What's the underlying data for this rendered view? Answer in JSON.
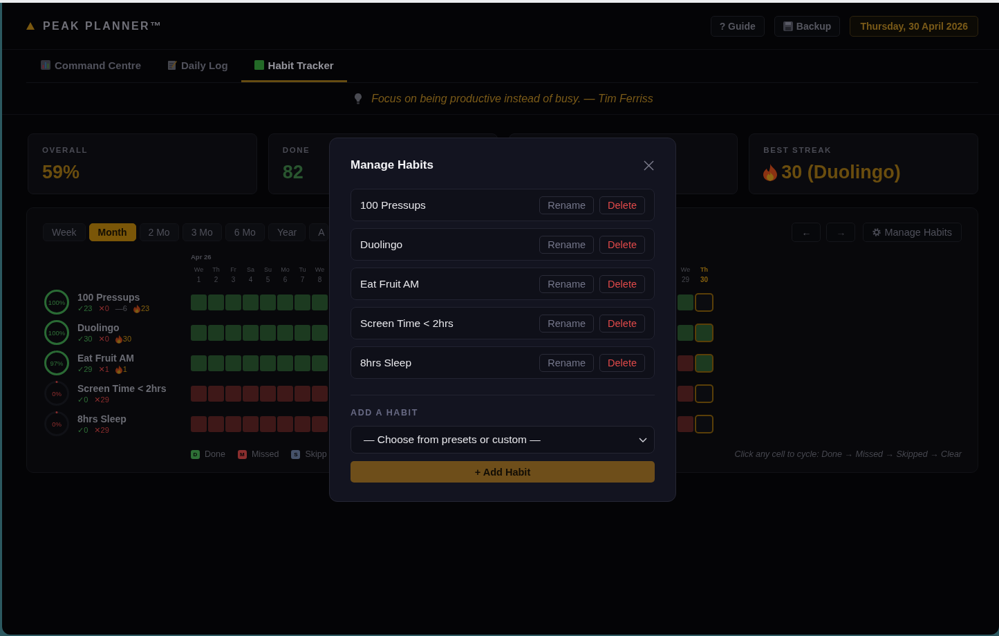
{
  "header": {
    "logo": "PEAK PLANNER™",
    "actions": [
      {
        "kind": "guide",
        "label": "? Guide"
      },
      {
        "kind": "backup",
        "label": "Backup"
      },
      {
        "kind": "date",
        "label": "Thursday, 30 April 2026"
      }
    ]
  },
  "tabs": [
    {
      "kind": "chart",
      "label": "Command Centre",
      "selected": false
    },
    {
      "kind": "memo",
      "label": "Daily Log",
      "selected": false
    },
    {
      "kind": "square",
      "label": "Habit Tracker",
      "selected": true
    }
  ],
  "quote": {
    "text": "Focus on being productive instead of busy. — Tim Ferriss"
  },
  "stats": [
    {
      "kind": "percent",
      "label": "OVERALL",
      "value": "59%",
      "color": "#6a4d0e"
    },
    {
      "kind": "count",
      "label": "DONE",
      "value": "82",
      "color": "#29552f"
    },
    {
      "kind": "streak",
      "label": "BEST STREAK",
      "value": "30 (Duolingo)",
      "color": "#6a4d0e"
    }
  ],
  "toolbar": {
    "ranges": [
      {
        "label": "Week",
        "selected": false
      },
      {
        "label": "Month",
        "selected": true
      },
      {
        "label": "2 Mo",
        "selected": false
      },
      {
        "label": "3 Mo",
        "selected": false
      },
      {
        "label": "6 Mo",
        "selected": false
      },
      {
        "label": "Year",
        "selected": false
      },
      {
        "label": "A",
        "selected": false
      }
    ],
    "nav": [
      {
        "label": "←",
        "disabled": false
      },
      {
        "label": "→",
        "disabled": true
      }
    ],
    "manage": "Manage Habits"
  },
  "grid": {
    "month_label": "Apr 26",
    "days_start": [
      {
        "weekday": "We",
        "date": "1",
        "today": false
      },
      {
        "weekday": "Th",
        "date": "2",
        "today": false
      },
      {
        "weekday": "Fr",
        "date": "3",
        "today": false
      },
      {
        "weekday": "Sa",
        "date": "4",
        "today": false
      },
      {
        "weekday": "Su",
        "date": "5",
        "today": false
      },
      {
        "weekday": "Mo",
        "date": "6",
        "today": false
      },
      {
        "weekday": "Tu",
        "date": "7",
        "today": false
      },
      {
        "weekday": "We",
        "date": "8",
        "today": false
      }
    ],
    "days_end": [
      {
        "weekday": "We",
        "date": "29",
        "today": false
      },
      {
        "weekday": "Th",
        "date": "30",
        "today": true
      }
    ],
    "habits": [
      {
        "name": "100 Pressups",
        "percent": "100%",
        "level": 1,
        "stats": [
          {
            "kind": "done",
            "text": "✓23"
          },
          {
            "kind": "missed",
            "text": "✕0"
          },
          {
            "kind": "skipped",
            "text": "—6"
          },
          {
            "kind": "streak",
            "text": "23"
          }
        ],
        "cells_start": [
          {
            "kind": "done"
          },
          {
            "kind": "done"
          },
          {
            "kind": "done"
          },
          {
            "kind": "done"
          },
          {
            "kind": "done"
          },
          {
            "kind": "done"
          },
          {
            "kind": "done"
          },
          {
            "kind": "done"
          }
        ],
        "cells_end": [
          {
            "kind": "done"
          },
          {
            "kind": "empty"
          }
        ]
      },
      {
        "name": "Duolingo",
        "percent": "100%",
        "level": 1,
        "stats": [
          {
            "kind": "done",
            "text": "✓30"
          },
          {
            "kind": "missed",
            "text": "✕0"
          },
          {
            "kind": "streak",
            "text": "30"
          }
        ],
        "cells_start": [
          {
            "kind": "done"
          },
          {
            "kind": "done"
          },
          {
            "kind": "done"
          },
          {
            "kind": "done"
          },
          {
            "kind": "done"
          },
          {
            "kind": "done"
          },
          {
            "kind": "done"
          },
          {
            "kind": "done"
          }
        ],
        "cells_end": [
          {
            "kind": "done"
          },
          {
            "kind": "done"
          }
        ]
      },
      {
        "name": "Eat Fruit AM",
        "percent": "97%",
        "level": 0.97,
        "stats": [
          {
            "kind": "done",
            "text": "✓29"
          },
          {
            "kind": "missed",
            "text": "✕1"
          },
          {
            "kind": "streak",
            "text": "1"
          }
        ],
        "cells_start": [
          {
            "kind": "done"
          },
          {
            "kind": "done"
          },
          {
            "kind": "done"
          },
          {
            "kind": "done"
          },
          {
            "kind": "done"
          },
          {
            "kind": "done"
          },
          {
            "kind": "done"
          },
          {
            "kind": "done"
          }
        ],
        "cells_end": [
          {
            "kind": "missed"
          },
          {
            "kind": "done"
          }
        ]
      },
      {
        "name": "Screen Time < 2hrs",
        "percent": "0%",
        "level": 0,
        "stats": [
          {
            "kind": "done",
            "text": "✓0"
          },
          {
            "kind": "missed",
            "text": "✕29"
          }
        ],
        "cells_start": [
          {
            "kind": "missed"
          },
          {
            "kind": "missed"
          },
          {
            "kind": "missed"
          },
          {
            "kind": "missed"
          },
          {
            "kind": "missed"
          },
          {
            "kind": "missed"
          },
          {
            "kind": "missed"
          },
          {
            "kind": "missed"
          }
        ],
        "cells_end": [
          {
            "kind": "missed"
          },
          {
            "kind": "empty"
          }
        ]
      },
      {
        "name": "8hrs Sleep",
        "percent": "0%",
        "level": 0,
        "stats": [
          {
            "kind": "done",
            "text": "✓0"
          },
          {
            "kind": "missed",
            "text": "✕29"
          }
        ],
        "cells_start": [
          {
            "kind": "missed"
          },
          {
            "kind": "missed"
          },
          {
            "kind": "missed"
          },
          {
            "kind": "missed"
          },
          {
            "kind": "missed"
          },
          {
            "kind": "missed"
          },
          {
            "kind": "missed"
          },
          {
            "kind": "missed"
          }
        ],
        "cells_end": [
          {
            "kind": "missed"
          },
          {
            "kind": "empty"
          }
        ]
      }
    ],
    "legend": [
      {
        "kind": "done",
        "letter": "D",
        "label": "Done"
      },
      {
        "kind": "missed",
        "letter": "M",
        "label": "Missed"
      },
      {
        "kind": "skipped",
        "letter": "S",
        "label": "Skipp"
      }
    ],
    "hint": "Click any cell to cycle: Done → Missed → Skipped → Clear"
  },
  "dialog": {
    "title": "Manage Habits",
    "habits": [
      {
        "name": "100 Pressups",
        "rename": "Rename",
        "delete": "Delete"
      },
      {
        "name": "Duolingo",
        "rename": "Rename",
        "delete": "Delete"
      },
      {
        "name": "Eat Fruit AM",
        "rename": "Rename",
        "delete": "Delete"
      },
      {
        "name": "Screen Time < 2hrs",
        "rename": "Rename",
        "delete": "Delete"
      },
      {
        "name": "8hrs Sleep",
        "rename": "Rename",
        "delete": "Delete"
      }
    ],
    "section_label": "ADD A HABIT",
    "select": {
      "value": "— Choose from presets or custom —"
    },
    "submit": "+ Add Habit"
  }
}
